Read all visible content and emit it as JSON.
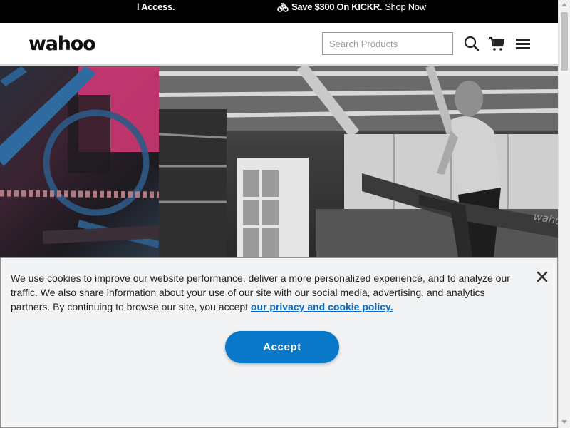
{
  "promo": {
    "left_text": "l Access.",
    "offer_text": "Save $300 On KICKR.",
    "shop_text": "Shop Now",
    "icon": "bike-icon"
  },
  "header": {
    "logo": "wahoo",
    "search": {
      "placeholder": "Search Products",
      "value": ""
    },
    "icons": [
      "search-icon",
      "cart-icon",
      "hamburger-menu-icon"
    ]
  },
  "hero": {
    "left_image": "bike-drivetrain-closeup",
    "right_image": "runner-on-treadmill-in-garage",
    "treadmill_brand": "wahoo"
  },
  "cookie_banner": {
    "message": "We use cookies to improve our website performance, deliver a more personalized experience, and to analyze our traffic. We also share information about your use of our site with our social media, advertising, and analytics partners. By continuing to browse our site, you accept",
    "link_text": "our privacy and cookie policy.",
    "accept_label": "Accept",
    "close_icon": "close-icon"
  },
  "colors": {
    "accent": "#0a78c8",
    "link": "#0a6cc2",
    "promo_bg": "#000000",
    "banner_bg": "#f2f3f4"
  }
}
